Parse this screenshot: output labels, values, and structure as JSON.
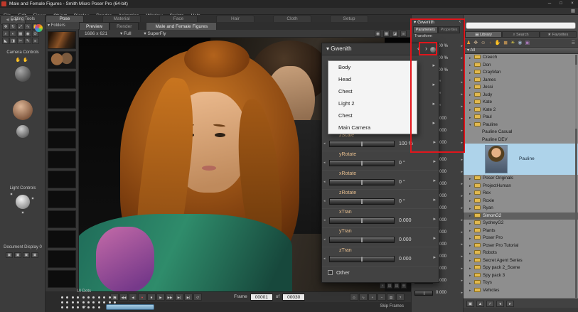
{
  "window": {
    "title": "Male and Female Figures - Smith Micro Poser Pro  (64-bit)"
  },
  "menu": {
    "items": [
      "File",
      "Edit",
      "Figure",
      "Object",
      "Display",
      "Render",
      "Animation",
      "Window",
      "Scripts",
      "Help"
    ]
  },
  "room_tabs": {
    "items": [
      "Pose",
      "Material",
      "Face",
      "Hair",
      "Cloth",
      "Setup"
    ],
    "active_index": 0
  },
  "left_panel": {
    "editing_tools_label": "Editing Tools",
    "camera_controls_label": "Camera Controls",
    "light_controls_label": "Light Controls",
    "document_display_label": "Document Display 0",
    "tool_icons": [
      "translate-tool",
      "rotate-tool",
      "scale-tool",
      "twist-tool",
      "grab-tool",
      "magnify-tool",
      "color-tool",
      "group-tool",
      "morph-tool",
      "chain-tool",
      "taper-tool",
      "view-tool",
      "cut-tool",
      "paint-tool",
      "menu-tool"
    ]
  },
  "folders_panel": {
    "title": "Folders",
    "thumbnail_count": 13
  },
  "viewport_bar": {
    "view_tabs": [
      "Preview",
      "Render"
    ],
    "active_view_tab": "Preview",
    "document_tab": "Male and Female Figures",
    "resolution": "1686 x 621",
    "size_mode": "Full",
    "renderer": "SuperFly"
  },
  "floating_panel": {
    "title": "Gwenith",
    "dropdown_items": [
      "Body",
      "Head",
      "Chest",
      "Light 2",
      "Chest",
      "Main Camera"
    ],
    "dials": [
      {
        "label": "zScale",
        "value": "100 %"
      },
      {
        "label": "yRotate",
        "value": "0 °"
      },
      {
        "label": "xRotate",
        "value": "0 °"
      },
      {
        "label": "zRotate",
        "value": "0 °"
      },
      {
        "label": "xTran",
        "value": "0.000"
      },
      {
        "label": "yTran",
        "value": "0.000"
      },
      {
        "label": "zTran",
        "value": "0.000"
      }
    ],
    "other_label": "Other"
  },
  "side_panel": {
    "title": "Gwenith",
    "tabs": [
      "Parameters",
      "Properties"
    ],
    "active_tab": "Parameters",
    "section_label": "Transform",
    "dial_values": [
      "100 %",
      "100 %",
      "100 %",
      "0 °",
      "0 °",
      "0 °",
      "0.000",
      "0.000",
      "0.000"
    ],
    "more_dial_values": [
      "0.000",
      "0.000",
      "0.000",
      "0.000",
      "0.000",
      "0.000",
      "0.000",
      "0.000",
      "0.000",
      "0.000",
      "0.000",
      "0.000"
    ]
  },
  "library": {
    "tabs": [
      "Library",
      "Search",
      "Favorites"
    ],
    "active_tab": "Library",
    "category_icons": [
      "figures",
      "poses",
      "expressions",
      "hair",
      "hands",
      "props",
      "lights",
      "cameras",
      "materials"
    ],
    "root_label": "All",
    "tree": [
      {
        "label": "Creech",
        "type": "folder"
      },
      {
        "label": "Don",
        "type": "folder"
      },
      {
        "label": "CrayMan",
        "type": "folder"
      },
      {
        "label": "James",
        "type": "folder"
      },
      {
        "label": "Jessi",
        "type": "folder"
      },
      {
        "label": "Judy",
        "type": "folder"
      },
      {
        "label": "Kate",
        "type": "folder"
      },
      {
        "label": "Kate 2",
        "type": "folder"
      },
      {
        "label": "Paul",
        "type": "folder"
      },
      {
        "label": "Pauline",
        "type": "folder-open"
      },
      {
        "label": "Pauline Casual",
        "type": "item"
      },
      {
        "label": "Pauline DEV",
        "type": "item"
      },
      {
        "label": "Pauline",
        "type": "thumbnail"
      },
      {
        "label": "Poser Originals",
        "type": "folder"
      },
      {
        "label": "ProjectHuman",
        "type": "folder"
      },
      {
        "label": "Rex",
        "type": "folder"
      },
      {
        "label": "Roxie",
        "type": "folder"
      },
      {
        "label": "Ryan",
        "type": "folder"
      },
      {
        "label": "SimonG2",
        "type": "folder",
        "selected": true
      },
      {
        "label": "SydneyG2",
        "type": "folder"
      },
      {
        "label": "Plants",
        "type": "folder"
      },
      {
        "label": "Poser Pro",
        "type": "folder"
      },
      {
        "label": "Poser Pro Tutorial",
        "type": "folder"
      },
      {
        "label": "Robots",
        "type": "folder"
      },
      {
        "label": "Secret Agent Series",
        "type": "folder"
      },
      {
        "label": "Spy pack 2_Scene",
        "type": "folder"
      },
      {
        "label": "Spy pack 3",
        "type": "folder"
      },
      {
        "label": "Toys",
        "type": "folder"
      },
      {
        "label": "Vehicles",
        "type": "folder"
      }
    ]
  },
  "playback": {
    "buttons": [
      "first-frame",
      "step-back-fast",
      "step-back",
      "record",
      "stop",
      "play",
      "step-forward",
      "step-forward-fast",
      "last-frame",
      "loop"
    ],
    "right_buttons": [
      "keyframe-edit",
      "graph",
      "add-key",
      "delete-key",
      "skip-settings",
      "help"
    ]
  },
  "timeline": {
    "frame_label": "Frame",
    "current_frame": "00001",
    "of_label": "of",
    "total_frames": "00030",
    "skip_frames_label": "Skip Frames",
    "ui_dots_label": "UI Dots"
  },
  "colors": {
    "annotation_red": "#e1151b",
    "selection_blue": "#aed3ea",
    "folder_yellow": "#e2b94e",
    "dial_label_tan": "#e5bd8e"
  }
}
